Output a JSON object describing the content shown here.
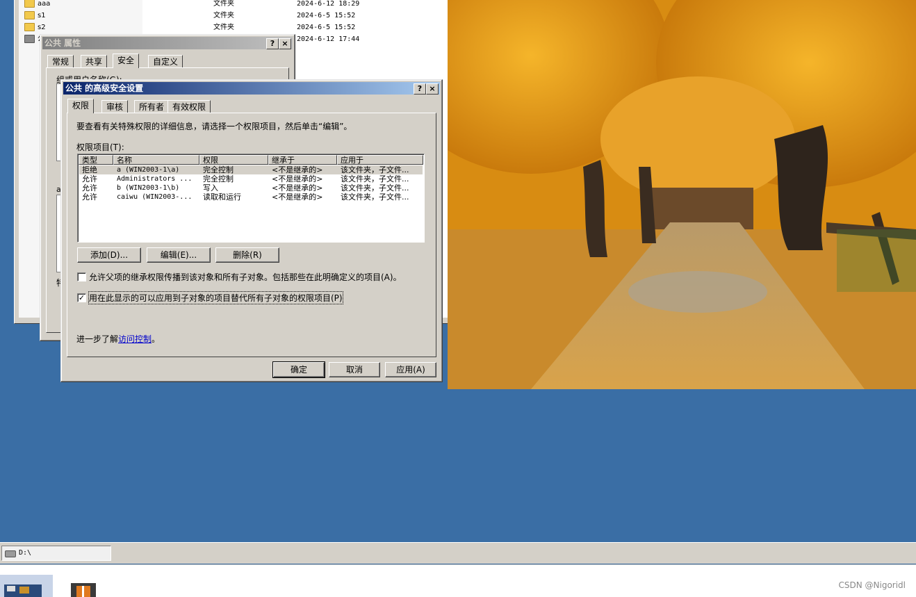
{
  "explorer": {
    "tree": [
      {
        "name": "aaa"
      },
      {
        "name": "s1"
      },
      {
        "name": "s2"
      },
      {
        "name": "公"
      }
    ],
    "files": [
      {
        "type": "文件夹",
        "date": "2024-6-12 18:29"
      },
      {
        "type": "文件夹",
        "date": "2024-6-5 15:52"
      },
      {
        "type": "文件夹",
        "date": "2024-6-5 15:52"
      },
      {
        "type": "",
        "date": "2024-6-12 17:44"
      }
    ]
  },
  "props_dialog": {
    "title": "公共 属性",
    "help": "?",
    "close": "×",
    "tabs": [
      "常规",
      "共享",
      "安全",
      "自定义"
    ],
    "selected_tab": "安全",
    "group_label": "组或用户名称(G):",
    "fragment_a": "a",
    "fragment_b": "特"
  },
  "adv_dialog": {
    "title": "公共 的高级安全设置",
    "help": "?",
    "close": "×",
    "tabs": [
      "权限",
      "审核",
      "所有者",
      "有效权限"
    ],
    "selected_tab": "权限",
    "intro": "要查看有关特殊权限的详细信息，请选择一个权限项目，然后单击“编辑”。",
    "list_label": "权限项目(T):",
    "columns": [
      "类型",
      "名称",
      "权限",
      "继承于",
      "应用于"
    ],
    "rows": [
      {
        "type": "拒绝",
        "name": "a (WIN2003-1\\a)",
        "perm": "完全控制",
        "inherit": "<不是继承的>",
        "apply": "该文件夹，子文件..."
      },
      {
        "type": "允许",
        "name": "Administrators ...",
        "perm": "完全控制",
        "inherit": "<不是继承的>",
        "apply": "该文件夹，子文件..."
      },
      {
        "type": "允许",
        "name": "b (WIN2003-1\\b)",
        "perm": "写入",
        "inherit": "<不是继承的>",
        "apply": "该文件夹，子文件..."
      },
      {
        "type": "允许",
        "name": "caiwu (WIN2003-...",
        "perm": "读取和运行",
        "inherit": "<不是继承的>",
        "apply": "该文件夹，子文件..."
      }
    ],
    "buttons": {
      "add": "添加(D)...",
      "edit": "编辑(E)...",
      "remove": "删除(R)"
    },
    "checkbox1": {
      "label": "允许父项的继承权限传播到该对象和所有子对象。包括那些在此明确定义的项目(A)。",
      "checked": false
    },
    "checkbox2": {
      "label": "用在此显示的可以应用到子对象的项目替代所有子对象的权限项目(P)",
      "checked": true
    },
    "learn_prefix": "进一步了解",
    "learn_link": "访问控制",
    "learn_suffix": "。",
    "ok": "确定",
    "cancel": "取消",
    "apply": "应用(A)"
  },
  "statusbar": {
    "address": "D:\\"
  },
  "watermark": "CSDN @Nigoridl",
  "colors": {
    "desktop": "#3a6ea5",
    "titlebar_active": "#0a246a",
    "titlebar_inactive": "#808080",
    "dialog": "#d4d0c8"
  }
}
